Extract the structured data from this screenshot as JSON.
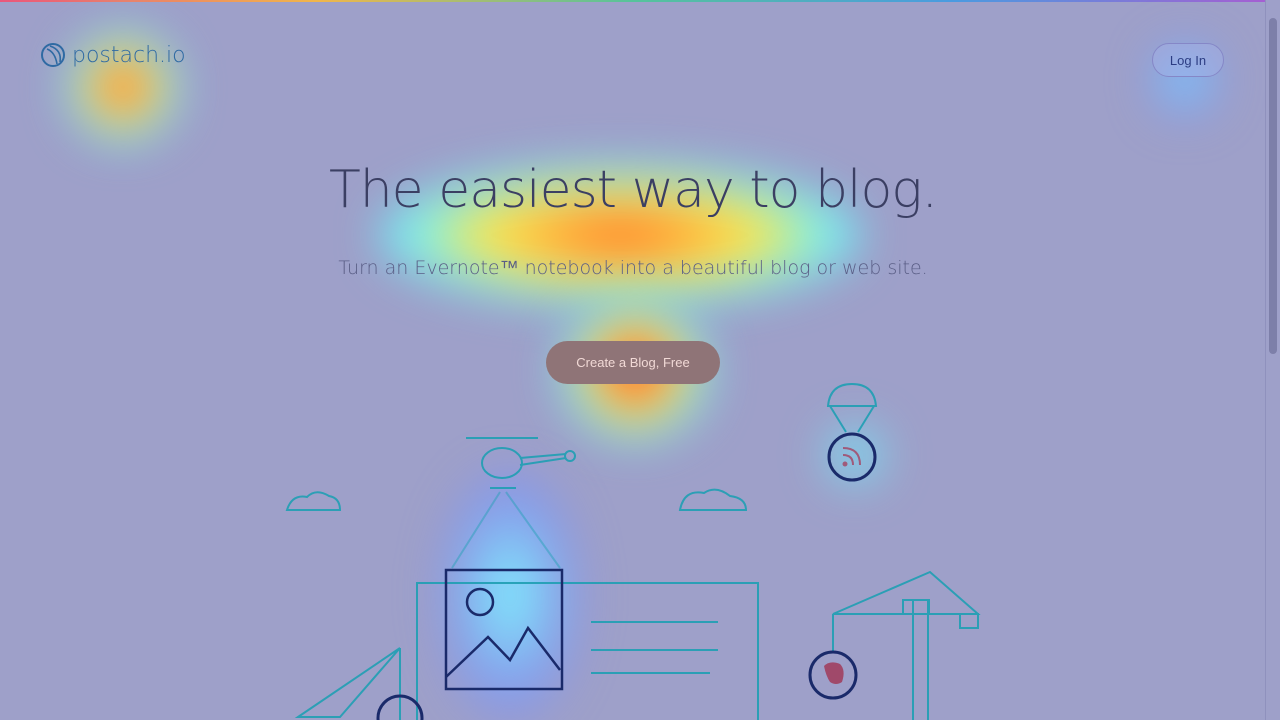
{
  "brand": {
    "name": "postach.io"
  },
  "nav": {
    "login_label": "Log In"
  },
  "hero": {
    "headline": "The easiest way to blog.",
    "subheadline": "Turn an Evernote™ notebook into a beautiful blog or web site.",
    "cta_label": "Create a Blog, Free"
  },
  "colors": {
    "background": "#9ea0c9",
    "accent_line": "#1f9fb3",
    "heat_hot": "#ff2a1a",
    "heat_warm": "#ffe94a",
    "heat_cool": "#5ef0ff"
  },
  "icons": [
    "postachio-logo-icon",
    "rss-icon",
    "evernote-elephant-icon",
    "image-placeholder-icon"
  ]
}
